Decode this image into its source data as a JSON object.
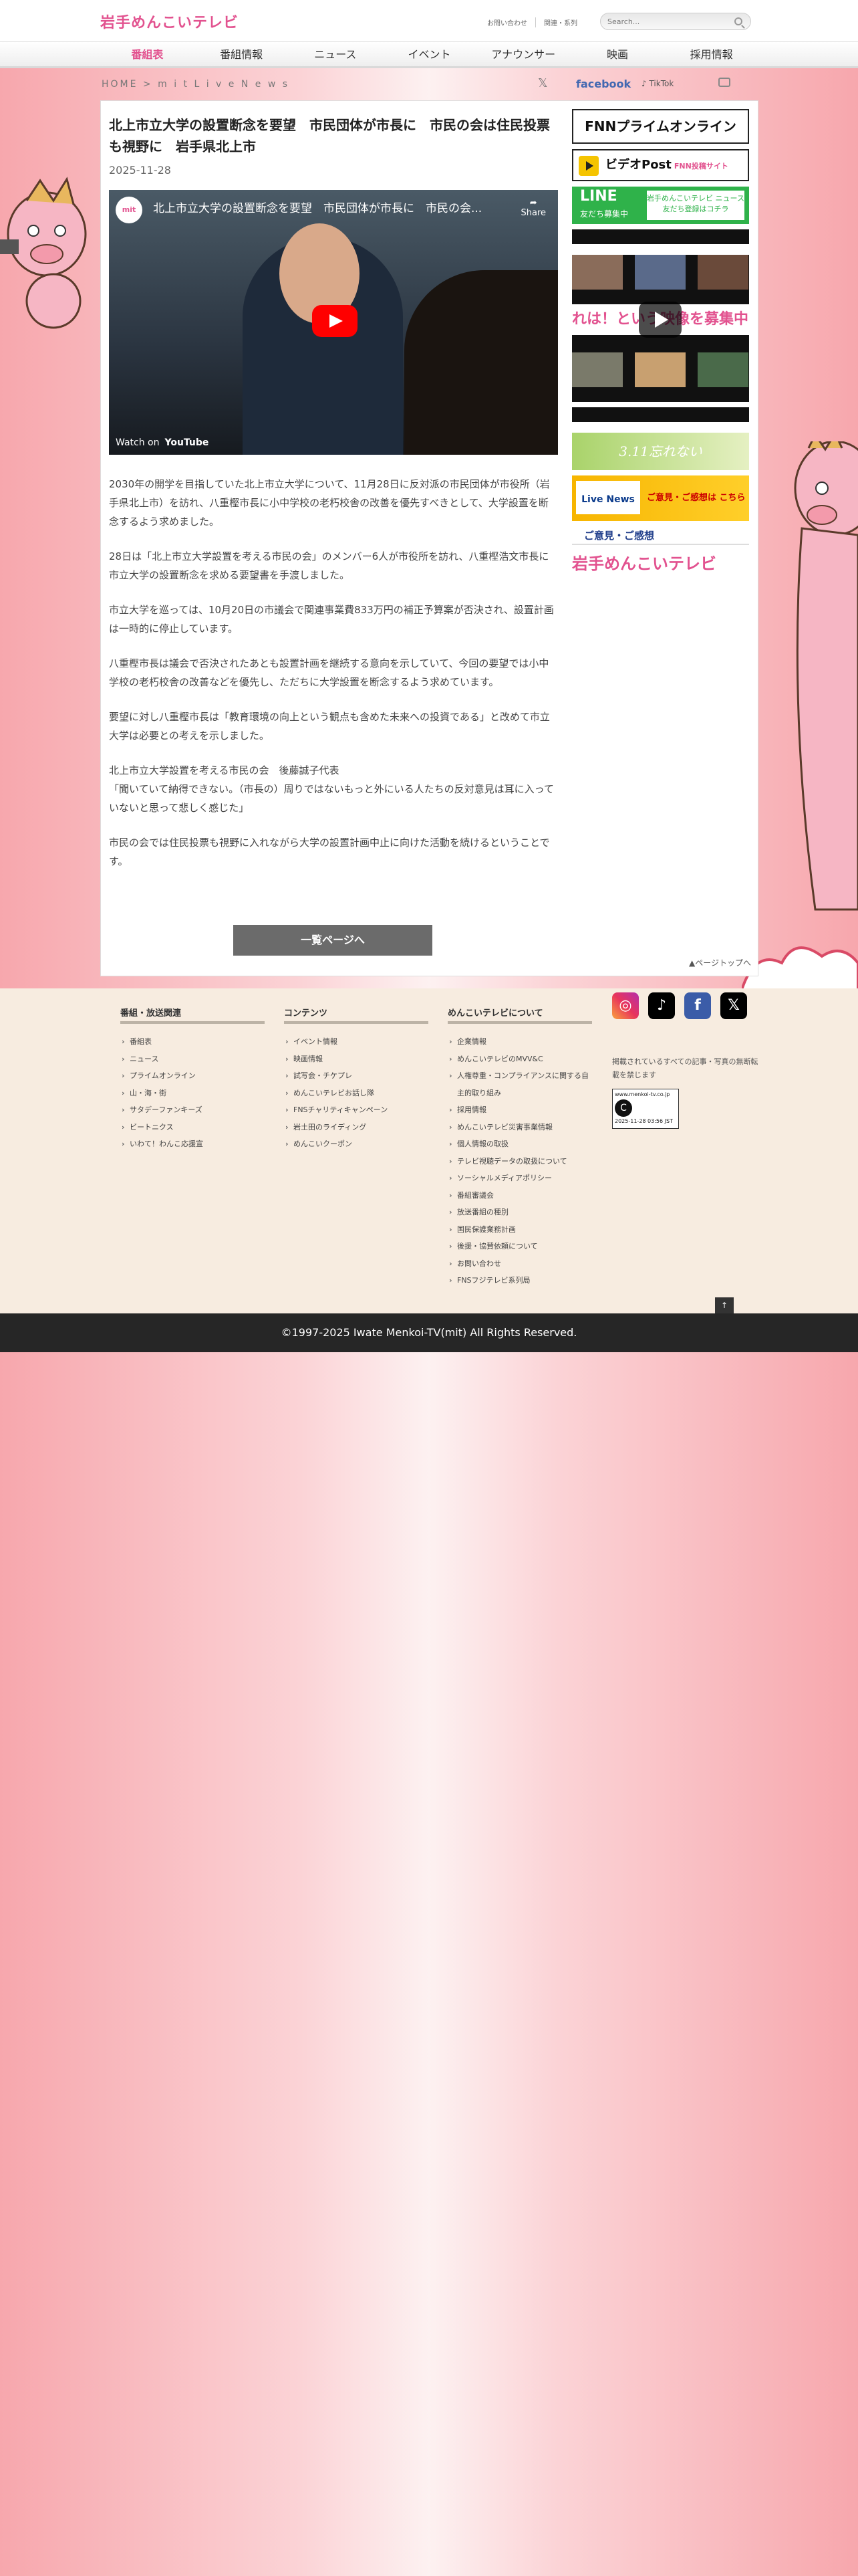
{
  "header": {
    "logo": "岩手めんこいテレビ",
    "links": [
      "お問い合わせ",
      "関連・系列"
    ],
    "search_placeholder": "Search..."
  },
  "gnav": [
    "番組表",
    "番組情報",
    "ニュース",
    "イベント",
    "アナウンサー",
    "映画",
    "採用情報"
  ],
  "breadcrumb": "HOME > m i t   L i v e   N e w s",
  "share": {
    "x": "𝕏",
    "facebook": "facebook",
    "tiktok": "♪ TikTok"
  },
  "article": {
    "title": "北上市立大学の設置断念を要望　市民団体が市長に　市民の会は住民投票も視野に　岩手県北上市",
    "date": "2025-11-28",
    "video": {
      "title": "北上市立大学の設置断念を要望　市民団体が市長に　市民の会...",
      "channel": "mit",
      "share": "Share",
      "watch": "Watch on",
      "platform": "YouTube"
    },
    "paragraphs": [
      "2030年の開学を目指していた北上市立大学について、11月28日に反対派の市民団体が市役所（岩手県北上市）を訪れ、八重樫市長に小中学校の老朽校舎の改善を優先すべきとして、大学設置を断念するよう求めました。",
      "28日は「北上市立大学設置を考える市民の会」のメンバー6人が市役所を訪れ、八重樫浩文市長に市立大学の設置断念を求める要望書を手渡しました。",
      "市立大学を巡っては、10月20日の市議会で関連事業費833万円の補正予算案が否決され、設置計画は一時的に停止しています。",
      "八重樫市長は議会で否決されたあとも設置計画を継続する意向を示していて、今回の要望では小中学校の老朽校舎の改善などを優先し、ただちに大学設置を断念するよう求めています。",
      "要望に対し八重樫市長は「教育環境の向上という観点も含めた未来への投資である」と改めて市立大学は必要との考えを示しました。",
      "北上市立大学設置を考える市民の会　後藤誠子代表\n「聞いていて納得できない。（市長の）周りではないもっと外にいる人たちの反対意見は耳に入っていないと思って悲しく感じた」",
      "市民の会では住民投票も視野に入れながら大学の設置計画中止に向けた活動を続けるということです。"
    ],
    "back_button": "一覧ページへ",
    "page_top": "▲ページトップへ"
  },
  "sidebar": {
    "fnn": "FNNプライムオンライン",
    "videopost": "ビデオPost",
    "videopost_sub": "FNN投稿サイト",
    "line_title": "LINE",
    "line_sub": "友だち募集中",
    "line_right": "岩手めんこいテレビ ニュース 友だち登録はコチラ",
    "grid_message": "れは！という映像を募集中",
    "b311": "3.11忘れない",
    "live_left": "Live News",
    "live_right": "ご意見・ご感想は こちら",
    "opinion": "ご意見・ご感想",
    "menkoi": "岩手めんこいテレビ"
  },
  "footer": {
    "col1_title": "番組・放送関連",
    "col1": [
      "番組表",
      "ニュース",
      "プライムオンライン",
      "山・海・街",
      "サタデーファンキーズ",
      "ビートニクス",
      "いわて！わんこ応援宣"
    ],
    "col2_title": "コンテンツ",
    "col2": [
      "イベント情報",
      "映画情報",
      "試写会・チケプレ",
      "めんこいテレビお話し隊",
      "FNSチャリティキャンペーン",
      "岩土田のライディング",
      "めんこいクーポン"
    ],
    "col3_title": "めんこいテレビについて",
    "col3": [
      "企業情報",
      "めんこいテレビのMVV&C",
      "人権尊重・コンプライアンスに関する自主的取り組み",
      "採用情報",
      "めんこいテレビ災害事業情報",
      "個人情報の取扱",
      "テレビ視聴データの取扱について",
      "ソーシャルメディアポリシー",
      "番組審議会",
      "放送番組の種別",
      "国民保護業務計画",
      "後援・協賛依頼について",
      "お問い合わせ",
      "FNSフジテレビ系列局"
    ],
    "note": "掲載されているすべての記事・写真の無断転載を禁じます",
    "stamp_url": "www.menkoi-tv.co.jp",
    "stamp_date": "2025-11-28 03:56 JST",
    "topbtn": "↑"
  },
  "copyright": "©1997-2025 Iwate Menkoi-TV(mit) All Rights Reserved."
}
